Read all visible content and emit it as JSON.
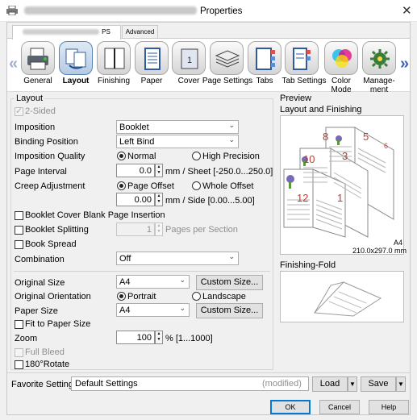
{
  "window": {
    "title": "Properties",
    "close_glyph": "✕"
  },
  "tabs": {
    "first": "PS",
    "second": "Advanced"
  },
  "nav": {
    "left_arrow": "«",
    "right_arrow": "»",
    "items": [
      {
        "label": "General",
        "icon": "printer-general-icon"
      },
      {
        "label": "Layout",
        "icon": "layout-icon",
        "selected": true
      },
      {
        "label": "Finishing",
        "icon": "finishing-icon"
      },
      {
        "label": "Paper",
        "icon": "paper-icon"
      },
      {
        "label": "Cover",
        "icon": "cover-icon"
      },
      {
        "label": "Page Settings",
        "icon": "page-settings-icon"
      },
      {
        "label": "Tabs",
        "icon": "tabs-icon"
      },
      {
        "label": "Tab Settings",
        "icon": "tab-settings-icon"
      },
      {
        "label": "Color Mode",
        "label_line1": "Color",
        "label_line2": "Mode",
        "icon": "color-mode-icon"
      },
      {
        "label": "Management",
        "label_line1": "Manage-",
        "label_line2": "ment",
        "icon": "management-icon"
      }
    ]
  },
  "layout": {
    "group_title": "Layout",
    "two_sided": "2-Sided",
    "imposition": {
      "label": "Imposition",
      "value": "Booklet"
    },
    "binding": {
      "label": "Binding Position",
      "value": "Left Bind"
    },
    "quality": {
      "label": "Imposition Quality",
      "option1": "Normal",
      "option2": "High Precision"
    },
    "interval": {
      "label": "Page Interval",
      "value": "0.0",
      "unit": "mm / Sheet [-250.0...250.0]"
    },
    "creep": {
      "label": "Creep Adjustment",
      "option1": "Page Offset",
      "option2": "Whole Offset",
      "value": "0.00",
      "unit": "mm / Side [0.00...5.00]"
    },
    "cover_blank": "Booklet Cover Blank Page Insertion",
    "splitting": {
      "label": "Booklet Splitting",
      "value": "1",
      "unit": "Pages per Section"
    },
    "spread": "Book Spread",
    "combination": {
      "label": "Combination",
      "value": "Off"
    },
    "original_size": {
      "label": "Original Size",
      "value": "A4",
      "button": "Custom Size..."
    },
    "orientation": {
      "label": "Original Orientation",
      "option1": "Portrait",
      "option2": "Landscape"
    },
    "paper_size": {
      "label": "Paper Size",
      "value": "A4",
      "button": "Custom Size..."
    },
    "fit": "Fit to Paper Size",
    "zoom": {
      "label": "Zoom",
      "value": "100",
      "unit": "% [1...1000]"
    },
    "full_bleed": "Full Bleed",
    "rotate": "180°Rotate"
  },
  "preview": {
    "title": "Preview",
    "section1": "Layout and Finishing",
    "paper_name": "A4",
    "paper_dims": "210.0x297.0 mm",
    "page_numbers": [
      "8",
      "5",
      "6",
      "10",
      "3",
      "12",
      "1"
    ],
    "section2": "Finishing-Fold"
  },
  "footer": {
    "favorite_label": "Favorite Setting",
    "favorite_value": "Default Settings",
    "modified": "(modified)",
    "load": "Load",
    "save": "Save",
    "ok": "OK",
    "cancel": "Cancel",
    "help": "Help"
  },
  "colors": {
    "accent": "#0078d7",
    "arrow_active": "#3b63b8",
    "page_number": "#c0392b"
  }
}
